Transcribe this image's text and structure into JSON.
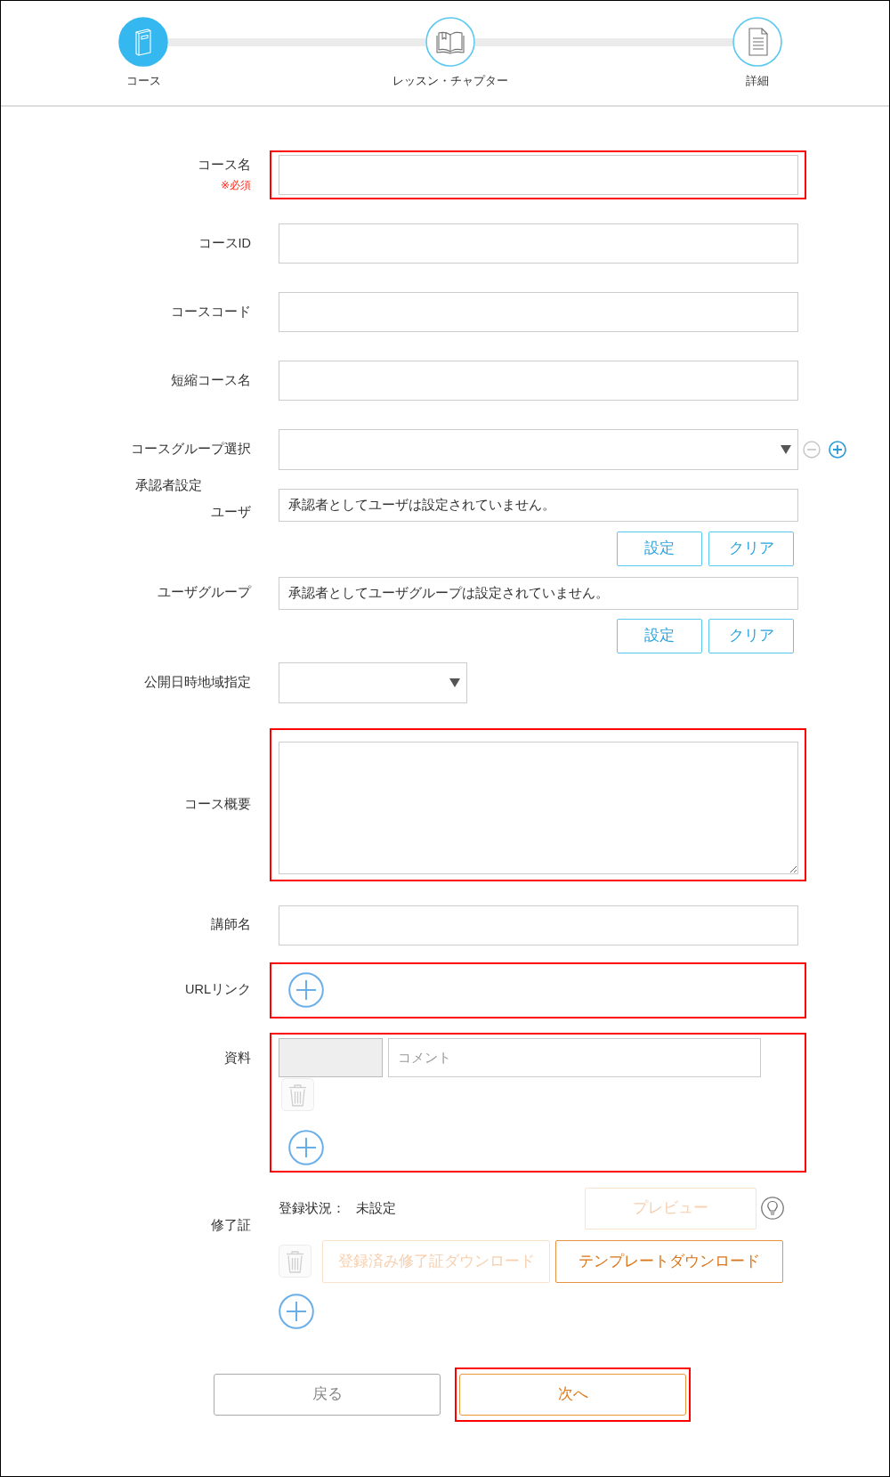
{
  "steps": [
    {
      "label": "コース",
      "selected": true
    },
    {
      "label": "レッスン・チャプター",
      "selected": false
    },
    {
      "label": "詳細",
      "selected": false
    }
  ],
  "fields": [
    {
      "kind": "text",
      "label": "コース名",
      "note": "※必須",
      "highlighted": true
    },
    {
      "kind": "text",
      "label": "コースID",
      "highlighted": false
    },
    {
      "kind": "text",
      "label": "コースコード",
      "highlighted": false
    },
    {
      "kind": "text",
      "label": "短縮コース名",
      "highlighted": false
    },
    {
      "kind": "select",
      "label": "コースグループ選択",
      "highlighted": false,
      "controls": [
        {
          "kind": "remove",
          "disabled": true
        },
        {
          "kind": "add",
          "disabled": false
        }
      ]
    },
    {
      "kind": "approvers",
      "label": "承認者設定",
      "rows": [
        {
          "label": "ユーザ",
          "value": "承認者としてユーザは設定されていません。",
          "buttons": [
            {
              "label": "設定"
            },
            {
              "label": "クリア"
            }
          ]
        },
        {
          "label": "ユーザグループ",
          "value": "承認者としてユーザグループは設定されていません。",
          "buttons": [
            {
              "label": "設定"
            },
            {
              "label": "クリア"
            }
          ]
        }
      ]
    },
    {
      "kind": "shortselect",
      "label": "公開日時地域指定",
      "highlighted": false
    },
    {
      "kind": "textarea",
      "label": "コース概要",
      "highlighted": true
    },
    {
      "kind": "text",
      "label": "講師名",
      "highlighted": false
    },
    {
      "kind": "links",
      "label": "URLリンク",
      "highlighted": true
    },
    {
      "kind": "materials",
      "label": "資料",
      "highlighted": true,
      "items": [
        {
          "placeholder": "コメント",
          "delete_disabled": true
        }
      ]
    },
    {
      "kind": "certificate",
      "label": "修了証",
      "status_label": "登録状況：",
      "status_value": "未設定",
      "preview": {
        "label": "プレビュー",
        "disabled": true
      },
      "delete_disabled": true,
      "downloads": [
        {
          "label": "登録済み修了証ダウンロード",
          "disabled": true
        },
        {
          "label": "テンプレートダウンロード",
          "disabled": false
        }
      ]
    }
  ],
  "footer": {
    "buttons": [
      {
        "kind": "back",
        "label": "戻る",
        "highlighted": false
      },
      {
        "kind": "next",
        "label": "次へ",
        "highlighted": true
      }
    ]
  }
}
